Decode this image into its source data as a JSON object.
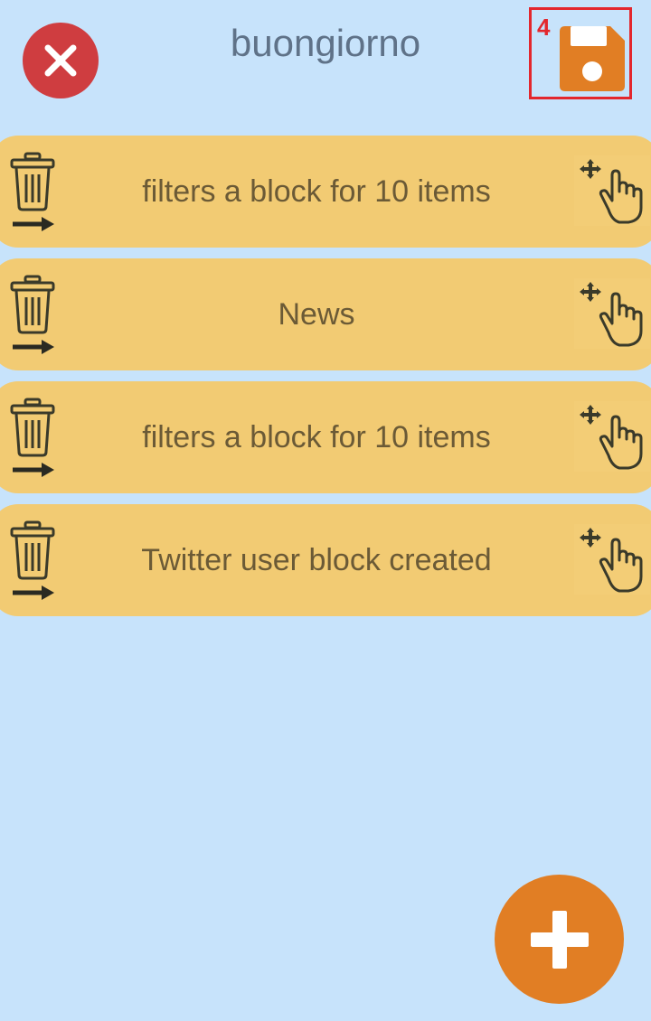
{
  "header": {
    "title": "buongiorno",
    "close_icon": "close-icon",
    "save_icon": "floppy-disk-icon",
    "annotation_number": "4"
  },
  "blocks": [
    {
      "label": "filters a block for 10 items"
    },
    {
      "label": "News"
    },
    {
      "label": "filters a block for 10 items"
    },
    {
      "label": "Twitter user block created"
    }
  ],
  "row_icons": {
    "delete": "trash-arrow-icon",
    "drag": "drag-hand-icon"
  },
  "fab": {
    "icon": "plus-icon"
  },
  "colors": {
    "background": "#c7e3fb",
    "row": "#f2cb73",
    "close": "#cf3d40",
    "save": "#e17e24",
    "fab": "#e17e24",
    "annotation": "#e3272d"
  }
}
